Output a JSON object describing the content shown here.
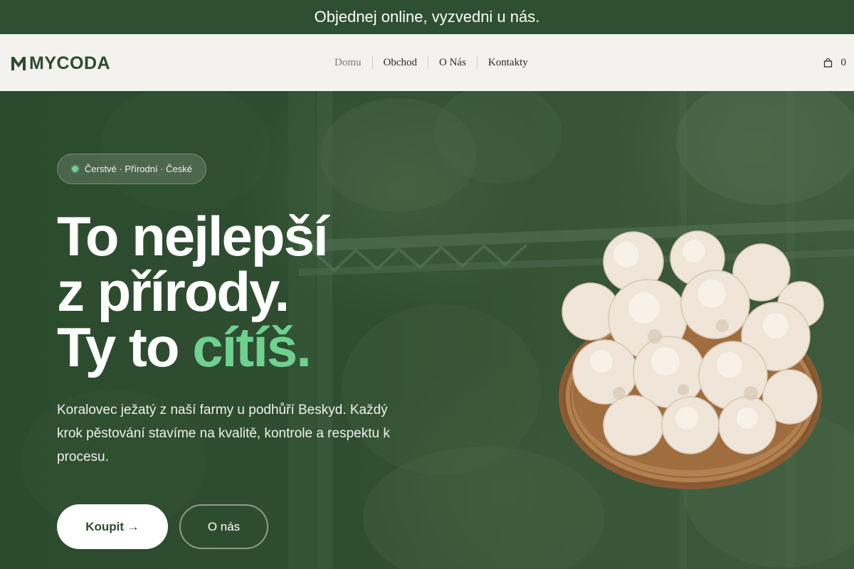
{
  "announcement": {
    "text": "Objednej online, vyzvedni u nás."
  },
  "header": {
    "logo_text": "MYCODA",
    "nav": [
      {
        "label": "Domu",
        "active": true
      },
      {
        "label": "Obchod",
        "active": false
      },
      {
        "label": "O Nás",
        "active": false
      },
      {
        "label": "Kontakty",
        "active": false
      }
    ],
    "cart": {
      "icon": "shopping-bag-icon",
      "count": "0"
    }
  },
  "hero": {
    "badge": "Čerstvé · Přírodní · České",
    "headline": {
      "line1": "To nejlepší",
      "line2": "z přírody.",
      "line3_prefix": "Ty to",
      "line3_accent": "cítíš."
    },
    "lead": "Koralovec ježatý z naší farmy u podhůří Beskyd. Každý krok pěstování stavíme na kvalitě, kontrole a respektu k procesu.",
    "buttons": {
      "buy": "Koupit →",
      "about": "O nás"
    },
    "image": "basket-of-lions-mane-mushrooms"
  },
  "colors": {
    "brand_green": "#2f4a30",
    "accent_green": "#6fd08f",
    "header_bg": "#f3f2ee",
    "announce_bg": "#2f4f32"
  }
}
